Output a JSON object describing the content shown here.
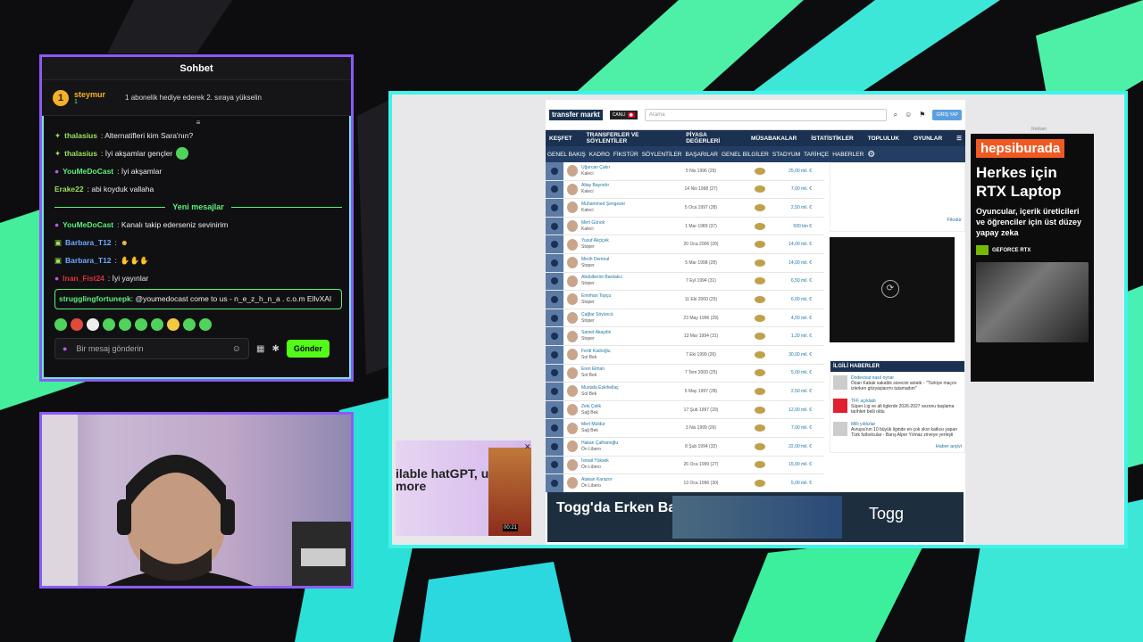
{
  "chat": {
    "title": "Sohbet",
    "pinned": {
      "rank": "1",
      "user": "steymur",
      "sub_count": "1",
      "text": "1 abonelik hediye ederek 2. sıraya yükselin"
    },
    "messages_before": [
      {
        "user": "thalasius",
        "text": ": Alternatifleri kim Sara'nın?",
        "color": "#9fe05a"
      },
      {
        "user": "thalasius",
        "text": ": İyi akşamlar gençler",
        "color": "#9fe05a"
      },
      {
        "user": "YouMeDoCast",
        "text": ": İyi akşamlar",
        "color": "#5cf07a"
      },
      {
        "user": "Erake22",
        "text": ": abi koyduk vallaha",
        "color": "#9fe05a"
      }
    ],
    "divider": "Yeni mesajlar",
    "messages_after": [
      {
        "user": "YouMeDoCast",
        "text": ": Kanalı takip ederseniz sevinirim",
        "color": "#5cf07a"
      },
      {
        "user": "Barbara_T12",
        "text": ": ",
        "color": "#6fa8ff"
      },
      {
        "user": "Barbara_T12",
        "text": ": ",
        "color": "#6fa8ff"
      },
      {
        "user": "Inan_Fist24",
        "text": ": İyi yayınlar",
        "color": "#e0303a"
      }
    ],
    "highlighted": {
      "user": "strugglingfortunepk",
      "text": ": @youmedocast come to us - n_e_z_h_n_a . c.o.m EllvXAI"
    },
    "input_placeholder": "Bir mesaj gönderin",
    "send_label": "Gönder"
  },
  "tm": {
    "logo": "transfer markt",
    "canli": "CANLI",
    "search_placeholder": "Arama",
    "login": "GİRİŞ YAP",
    "nav": [
      "KEŞFET",
      "TRANSFERLER VE SÖYLENTİLER",
      "PİYASA DEĞERLERİ",
      "MÜSABAKALAR",
      "İSTATİSTİKLER",
      "TOPLULUK",
      "OYUNLAR"
    ],
    "subnav": [
      "GENEL BAKIŞ",
      "KADRO",
      "FİKSTÜR",
      "SÖYLENTİLER",
      "BAŞARILAR",
      "GENEL BİLGİLER",
      "STADYUM",
      "TARİHÇE",
      "HABERLER"
    ],
    "players": [
      {
        "name": "Uğurcan Çakır",
        "pos": "Kaleci",
        "date": "5 Nis 1996 (29)",
        "value": "25,00 mil. €"
      },
      {
        "name": "Altay Bayındır",
        "pos": "Kaleci",
        "date": "14 Nis 1998 (27)",
        "value": "7,00 mil. €"
      },
      {
        "name": "Muhammed Şengezer",
        "pos": "Kaleci",
        "date": "5 Oca 1997 (28)",
        "value": "2,50 mil. €"
      },
      {
        "name": "Mert Günok",
        "pos": "Kaleci",
        "date": "1 Mar 1989 (37)",
        "value": "500 bin €"
      },
      {
        "name": "Yusuf Akçiçek",
        "pos": "Stoper",
        "date": "20 Oca 2006 (20)",
        "value": "14,00 mil. €"
      },
      {
        "name": "Merih Demiral",
        "pos": "Stoper",
        "date": "5 Mar 1998 (28)",
        "value": "14,00 mil. €"
      },
      {
        "name": "Abdülkerim Bardakcı",
        "pos": "Stoper",
        "date": "7 Eyl 1994 (31)",
        "value": "6,50 mil. €"
      },
      {
        "name": "Emirhan Topçu",
        "pos": "Stoper",
        "date": "11 Eki 2000 (25)",
        "value": "6,00 mil. €"
      },
      {
        "name": "Çağlar Söyüncü",
        "pos": "Stoper",
        "date": "23 May 1996 (29)",
        "value": "4,50 mil. €"
      },
      {
        "name": "Samet Akaydin",
        "pos": "Stoper",
        "date": "13 Mar 1994 (31)",
        "value": "1,20 mil. €"
      },
      {
        "name": "Ferdi Kadıoğlu",
        "pos": "Sol Bek",
        "date": "7 Eki 1999 (26)",
        "value": "30,00 mil. €"
      },
      {
        "name": "Eren Elmalı",
        "pos": "Sol Bek",
        "date": "7 Tem 2000 (25)",
        "value": "5,00 mil. €"
      },
      {
        "name": "Mustafa Eskihellaç",
        "pos": "Sol Bek",
        "date": "5 May 1997 (28)",
        "value": "2,50 mil. €"
      },
      {
        "name": "Zeki Çelik",
        "pos": "Sağ Bek",
        "date": "17 Şub 1997 (29)",
        "value": "12,00 mil. €"
      },
      {
        "name": "Mert Müldür",
        "pos": "Sağ Bek",
        "date": "3 Nis 1999 (26)",
        "value": "7,00 mil. €"
      },
      {
        "name": "Hakan Çalhanoğlu",
        "pos": "Ön Libero",
        "date": "8 Şub 1994 (32)",
        "value": "22,00 mil. €"
      },
      {
        "name": "İsmail Yüksek",
        "pos": "Ön Libero",
        "date": "26 Oca 1999 (27)",
        "value": "15,00 mil. €"
      },
      {
        "name": "Atakan Karazor",
        "pos": "Ön Libero",
        "date": "13 Oca 1996 (30)",
        "value": "5,00 mil. €"
      }
    ],
    "news_title": "İLGİLİ HABERLER",
    "news": [
      {
        "tag": "Dodevisat nasıl oynar",
        "text": "Özan Kabak sakatlık sürecini anlattı - \"Türkiye maçını izlerken gözyaşlarımı tutamadım\""
      },
      {
        "tag": "TFF açıkladı",
        "text": "Süper Lig ve alt liglerde 2026-2027 sezonu başlama tarihleri belli oldu"
      },
      {
        "tag": "Milli yıldızlar",
        "text": "Avrupa'nın 10 büyük liginde en çok skor katkısı yapan Türk futbolcular - Barış Alper Yılmaz zirveye yerleşti"
      }
    ],
    "fikstur_link": "Fikstür",
    "haber_link": "Haber arşivi"
  },
  "ads": {
    "reklam": "Reklam",
    "right_brand": "hepsiburada",
    "right_headline": "Herkes için RTX Laptop",
    "right_sub": "Oyuncular, içerik üreticileri ve öğrenciler için üst düzey yapay zeka",
    "right_gpu": "GEFORCE RTX",
    "left_text": "ilable hatGPT, ude & more",
    "left_time": "00:21",
    "bottom_text": "Togg'da Erken Bayram Fırsatları",
    "bottom_brand": "Togg"
  }
}
